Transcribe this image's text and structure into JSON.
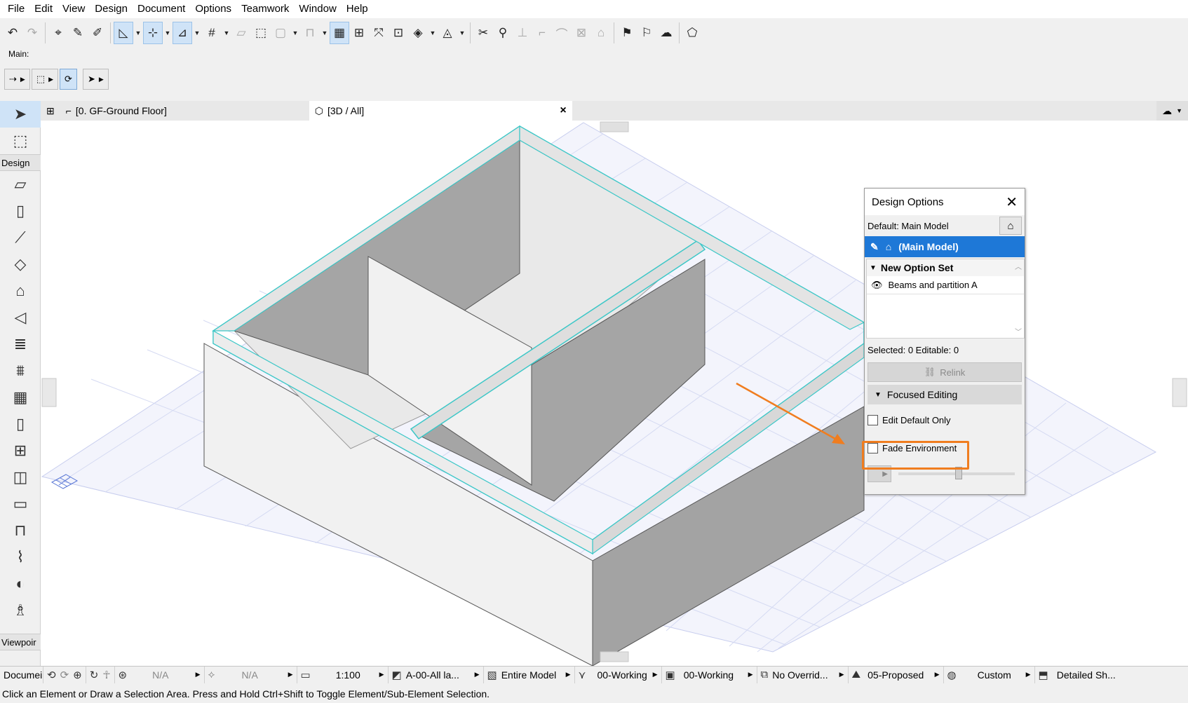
{
  "menu": [
    "File",
    "Edit",
    "View",
    "Design",
    "Document",
    "Options",
    "Teamwork",
    "Window",
    "Help"
  ],
  "toolbox": {
    "main_label": "Main:",
    "design_label": "Design",
    "viewpoint_label": "Viewpoir",
    "document_label": "Documei"
  },
  "tabs": {
    "floor": "[0. GF-Ground Floor]",
    "view3d": "[3D / All]",
    "close": "×"
  },
  "design_options": {
    "title": "Design Options",
    "close": "✕",
    "default_label": "Default: Main Model",
    "main_model": "(Main Model)",
    "option_set": "New Option Set",
    "option_item": "Beams and partition A",
    "selected_info": "Selected: 0 Editable: 0",
    "relink_label": "Relink",
    "focused_editing": "Focused Editing",
    "edit_default_only": "Edit Default Only",
    "fade_environment": "Fade Environment",
    "fade_level": 0.52
  },
  "status": {
    "na1": "N/A",
    "na2": "N/A",
    "scale": "1:100",
    "layer": "A-00-All la...",
    "model": "Entire Model",
    "pen": "00-Working",
    "view": "00-Working",
    "override": "No Overrid...",
    "renovation": "05-Proposed",
    "custom": "Custom",
    "detail": "Detailed Sh..."
  },
  "hint": "Click an Element or Draw a Selection Area. Press and Hold Ctrl+Shift to Toggle Element/Sub-Element Selection.",
  "colors": {
    "accent_blue": "#1e78d7",
    "highlight_orange": "#f07d1f",
    "wall_top": "#e6e6e6",
    "wall_side_light": "#f1f1f1",
    "wall_side_dark": "#a3a3a3",
    "edge_cyan": "#3cc7c7"
  }
}
